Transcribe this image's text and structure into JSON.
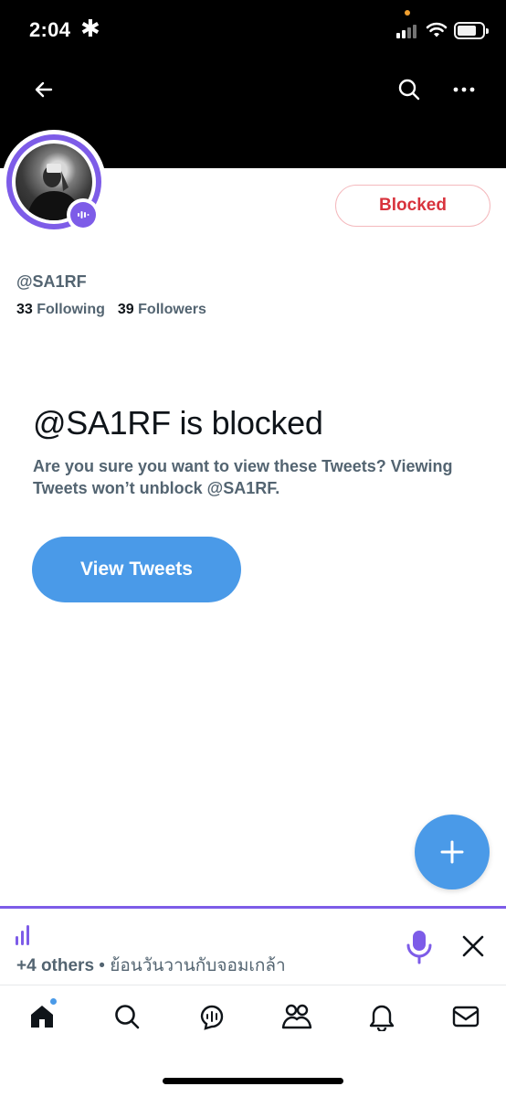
{
  "status_bar": {
    "time": "2:04",
    "asterisk": "✱",
    "icons": [
      "signal-icon",
      "wifi-icon",
      "battery-icon"
    ]
  },
  "header": {
    "back_icon": "back-arrow-icon",
    "search_icon": "search-icon",
    "more_icon": "more-icon"
  },
  "profile": {
    "handle": "@SA1RF",
    "following_count": "33",
    "following_label": "Following",
    "followers_count": "39",
    "followers_label": "Followers",
    "blocked_button": "Blocked",
    "avatar_ring_color": "#7d5ce8"
  },
  "blocked_notice": {
    "title": "@SA1RF is blocked",
    "description": "Are you sure you want to view these Tweets? Viewing Tweets won’t unblock @SA1RF.",
    "button": "View Tweets"
  },
  "spaces_bar": {
    "others": "+4 others",
    "separator": "•",
    "space_title": "ย้อนวันวานกับจอมเกล้า",
    "accent_color": "#7d5ce8"
  },
  "colors": {
    "accent": "#4a9ae8",
    "blocked_red": "#d8333d",
    "secondary_text": "#536471"
  },
  "tabbar": {
    "items": [
      "home-icon",
      "search-icon",
      "spaces-icon",
      "communities-icon",
      "notifications-icon",
      "messages-icon"
    ]
  }
}
